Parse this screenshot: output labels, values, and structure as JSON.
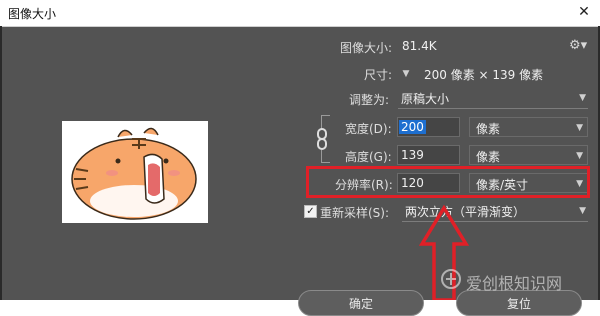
{
  "window": {
    "title": "图像大小"
  },
  "info": {
    "size_label": "图像大小:",
    "size_value": "81.4K",
    "dimensions_label": "尺寸:",
    "dimensions_value": "200 像素  ×  139 像素"
  },
  "fit": {
    "label": "调整为:",
    "value": "原稿大小"
  },
  "width": {
    "label": "宽度(D):",
    "value": "200",
    "unit": "像素"
  },
  "height": {
    "label": "高度(G):",
    "value": "139",
    "unit": "像素"
  },
  "resolution": {
    "label": "分辨率(R):",
    "value": "120",
    "unit": "像素/英寸"
  },
  "resample": {
    "label": "重新采样(S):",
    "value": "两次立方（平滑渐变）",
    "checked": true
  },
  "buttons": {
    "ok": "确定",
    "cancel": "复位"
  },
  "watermark": {
    "text": "爱创根知识网"
  },
  "colors": {
    "panel": "#535353",
    "highlight": "#e02027",
    "selection": "#1e6fd0",
    "tiger": "#f7a66a"
  }
}
